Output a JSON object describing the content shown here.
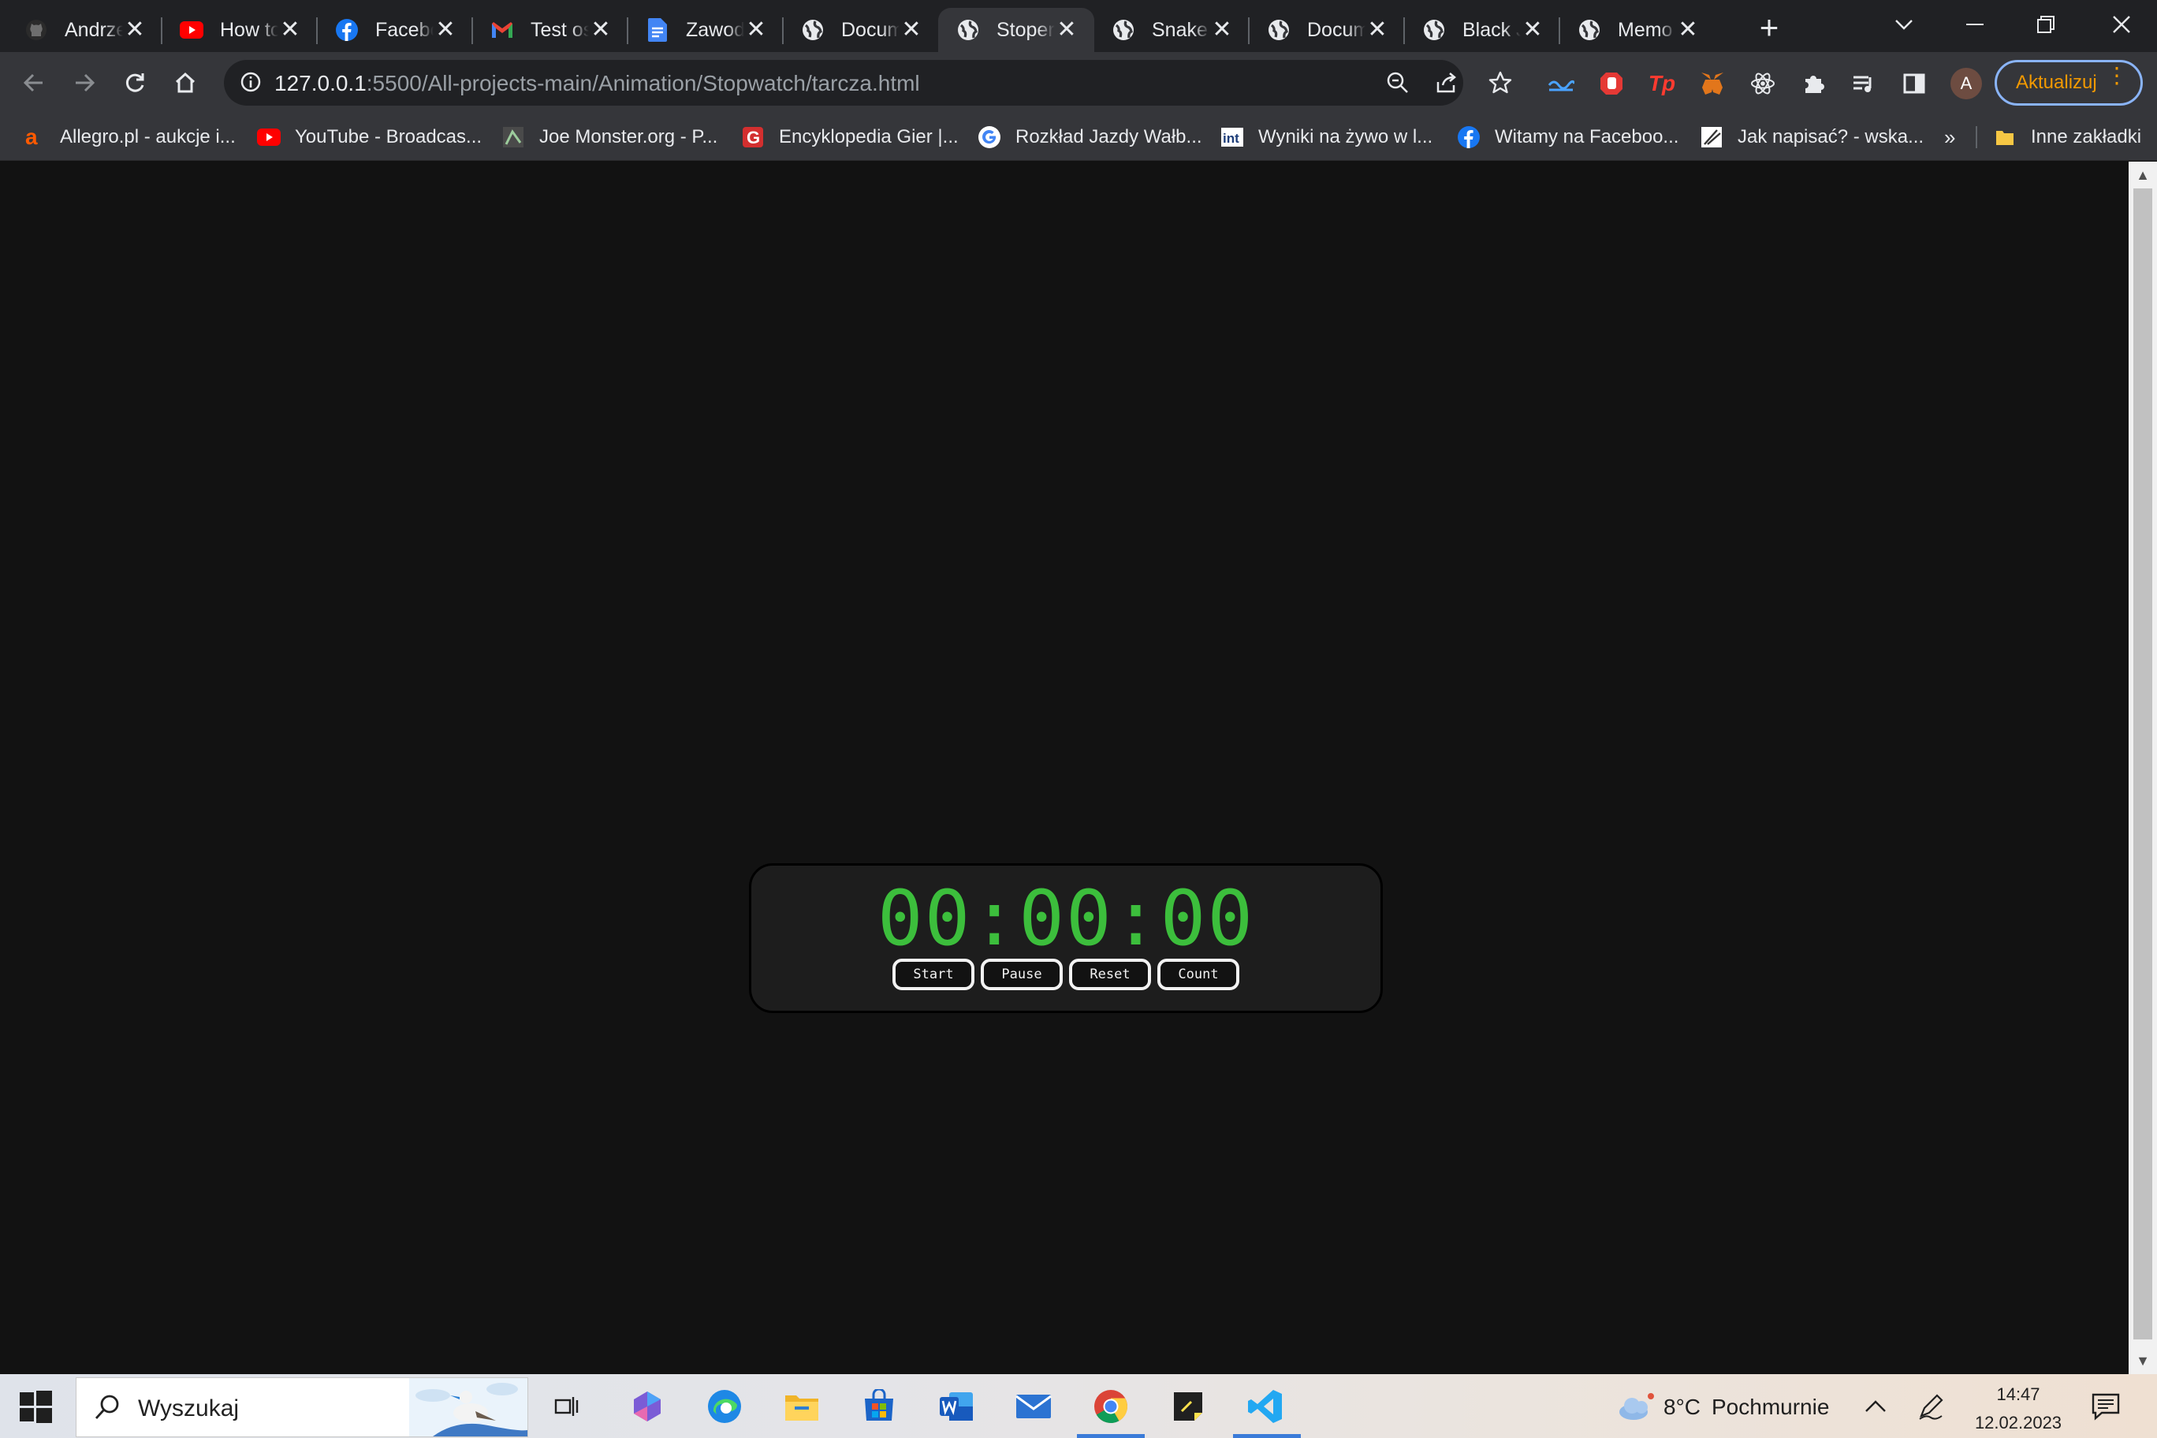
{
  "browser": {
    "tabs": [
      {
        "title": "Andrzej",
        "icon": "github-icon"
      },
      {
        "title": "How to",
        "icon": "youtube-icon"
      },
      {
        "title": "Facebook",
        "icon": "facebook-icon"
      },
      {
        "title": "Test os",
        "icon": "gmail-icon"
      },
      {
        "title": "Zawody",
        "icon": "docs-icon"
      },
      {
        "title": "Docum",
        "icon": "globe-icon"
      },
      {
        "title": "Stoper",
        "icon": "globe-icon",
        "active": true
      },
      {
        "title": "Snake",
        "icon": "globe-icon"
      },
      {
        "title": "Docum",
        "icon": "globe-icon"
      },
      {
        "title": "Black J",
        "icon": "globe-icon"
      },
      {
        "title": "Memo",
        "icon": "globe-icon"
      }
    ],
    "close_glyph": "✕",
    "new_tab_glyph": "+",
    "url_host": "127.0.0.1",
    "url_path": ":5500/All-projects-main/Animation/Stopwatch/tarcza.html",
    "avatar_letter": "A",
    "update_label": "Aktualizuj",
    "bookmarks": [
      {
        "label": "Allegro.pl - aukcje i...",
        "icon": "allegro-icon"
      },
      {
        "label": "YouTube - Broadcas...",
        "icon": "youtube-icon"
      },
      {
        "label": "Joe Monster.org - P...",
        "icon": "joemonster-icon"
      },
      {
        "label": "Encyklopedia Gier |...",
        "icon": "gry-icon"
      },
      {
        "label": "Rozkład Jazdy Wałb...",
        "icon": "google-icon"
      },
      {
        "label": "Wyniki na żywo w l...",
        "icon": "interia-icon"
      },
      {
        "label": "Witamy na Faceboo...",
        "icon": "facebook-icon"
      },
      {
        "label": "Jak napisać? - wska...",
        "icon": "jaknapisac-icon"
      }
    ],
    "bookmarks_more": "»",
    "other_bookmarks": "Inne zakładki"
  },
  "stopwatch": {
    "time": "00:00:00",
    "buttons": {
      "start": "Start",
      "pause": "Pause",
      "reset": "Reset",
      "count": "Count"
    },
    "digit_color": "#3cbe3c"
  },
  "taskbar": {
    "search_placeholder": "Wyszukaj",
    "weather_temp": "8°C",
    "weather_desc": "Pochmurnie",
    "time": "14:47",
    "date": "12.02.2023"
  }
}
